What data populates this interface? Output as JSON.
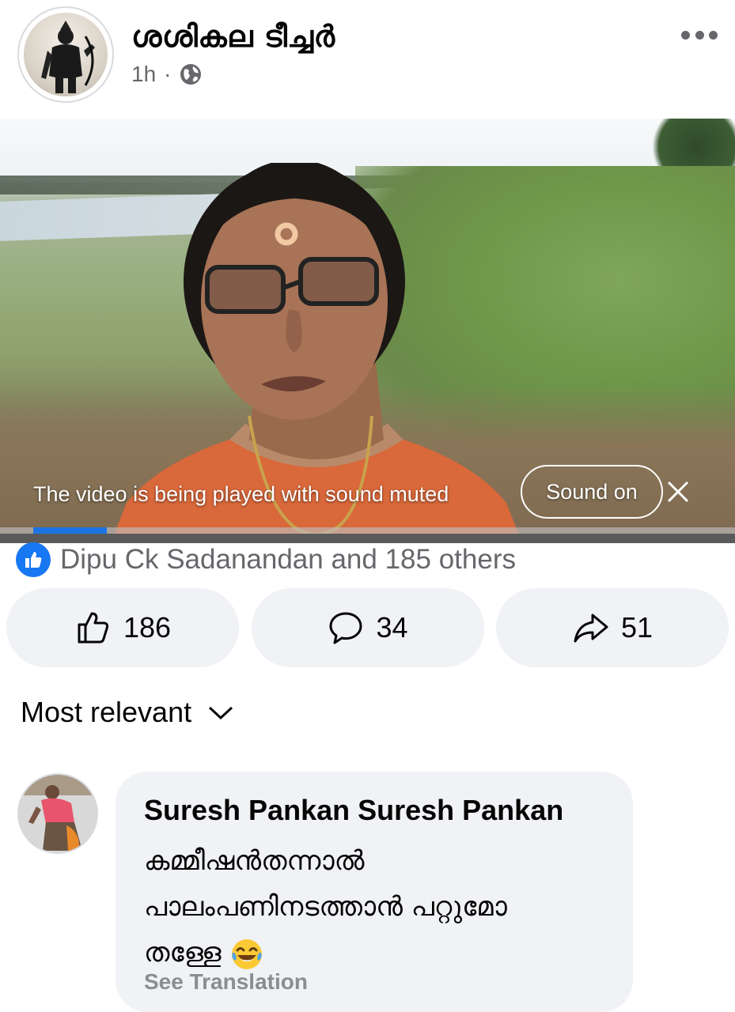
{
  "post": {
    "author": "ശശികല ടീച്ചർ",
    "time": "1h",
    "separator": "·",
    "privacy_icon": "globe-icon",
    "more_icon": "more-horizontal-icon"
  },
  "video": {
    "mute_notice": "The video is being played with sound muted",
    "sound_on_label": "Sound on",
    "close_icon": "close-icon",
    "progress": 0.05
  },
  "reactions": {
    "summary": "Dipu Ck Sadanandan and 185 others",
    "icon": "like-badge-icon"
  },
  "actions": {
    "like_count": "186",
    "comment_count": "34",
    "share_count": "51"
  },
  "comments": {
    "sort_label": "Most relevant",
    "items": [
      {
        "author": "Suresh Pankan Suresh Pankan",
        "text": "കമ്മീഷൻതന്നാൽ\nപാലംപണിനടത്താൻ പറ്റുമോ\nതള്ളേ",
        "emoji": "laughing-tears-emoji",
        "translate_label": "See Translation"
      }
    ]
  },
  "colors": {
    "accent": "#1877f2",
    "secondary_text": "#65676b",
    "bubble_bg": "#f0f2f5"
  }
}
